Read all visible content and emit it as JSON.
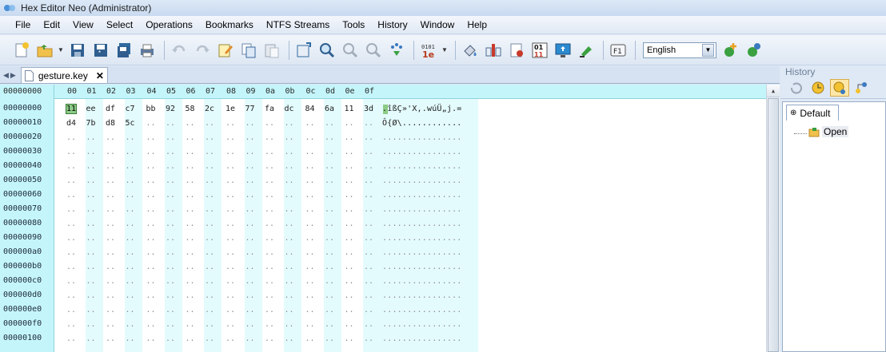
{
  "window": {
    "title": "Hex Editor Neo (Administrator)"
  },
  "menu": [
    "File",
    "Edit",
    "View",
    "Select",
    "Operations",
    "Bookmarks",
    "NTFS Streams",
    "Tools",
    "History",
    "Window",
    "Help"
  ],
  "toolbar": {
    "language": "English",
    "icons": [
      "new-file-icon",
      "open-folder-icon",
      "save-icon",
      "save-as-icon",
      "save-all-icon",
      "print-icon",
      "undo-icon",
      "redo-icon",
      "edit-icon",
      "copy-icon",
      "paste-icon",
      "goto-icon",
      "find-icon",
      "find-prev-icon",
      "find-next-icon",
      "mark-icon",
      "bytes-grouping-icon",
      "fill-icon",
      "insert-pattern-icon",
      "checksum-icon",
      "binary-icon",
      "fullscreen-icon",
      "highlight-icon",
      "help-icon",
      "add-plugin-icon",
      "update-icon"
    ]
  },
  "tab": {
    "filename": "gesture.key",
    "close": "✕"
  },
  "hex": {
    "corner": "00000000",
    "columns": [
      "00",
      "01",
      "02",
      "03",
      "04",
      "05",
      "06",
      "07",
      "08",
      "09",
      "0a",
      "0b",
      "0c",
      "0d",
      "0e",
      "0f"
    ],
    "offsets": [
      "00000000",
      "00000010",
      "00000020",
      "00000030",
      "00000040",
      "00000050",
      "00000060",
      "00000070",
      "00000080",
      "00000090",
      "000000a0",
      "000000b0",
      "000000c0",
      "000000d0",
      "000000e0",
      "000000f0",
      "00000100"
    ],
    "rows": [
      [
        "11",
        "ee",
        "df",
        "c7",
        "bb",
        "92",
        "58",
        "2c",
        "1e",
        "77",
        "fa",
        "dc",
        "84",
        "6a",
        "11",
        "3d"
      ],
      [
        "d4",
        "7b",
        "d8",
        "5c",
        "..",
        "..",
        "..",
        "..",
        "..",
        "..",
        "..",
        "..",
        "..",
        "..",
        "..",
        ".."
      ]
    ],
    "empty_cell": "..",
    "ascii": [
      ".îßÇ»'X,.wúÜ„j.=",
      "Ô{Ø\\............"
    ],
    "empty_ascii": "................",
    "selected_byte": "11"
  },
  "history": {
    "title": "History",
    "tab": "Default",
    "items": [
      "Open"
    ]
  }
}
